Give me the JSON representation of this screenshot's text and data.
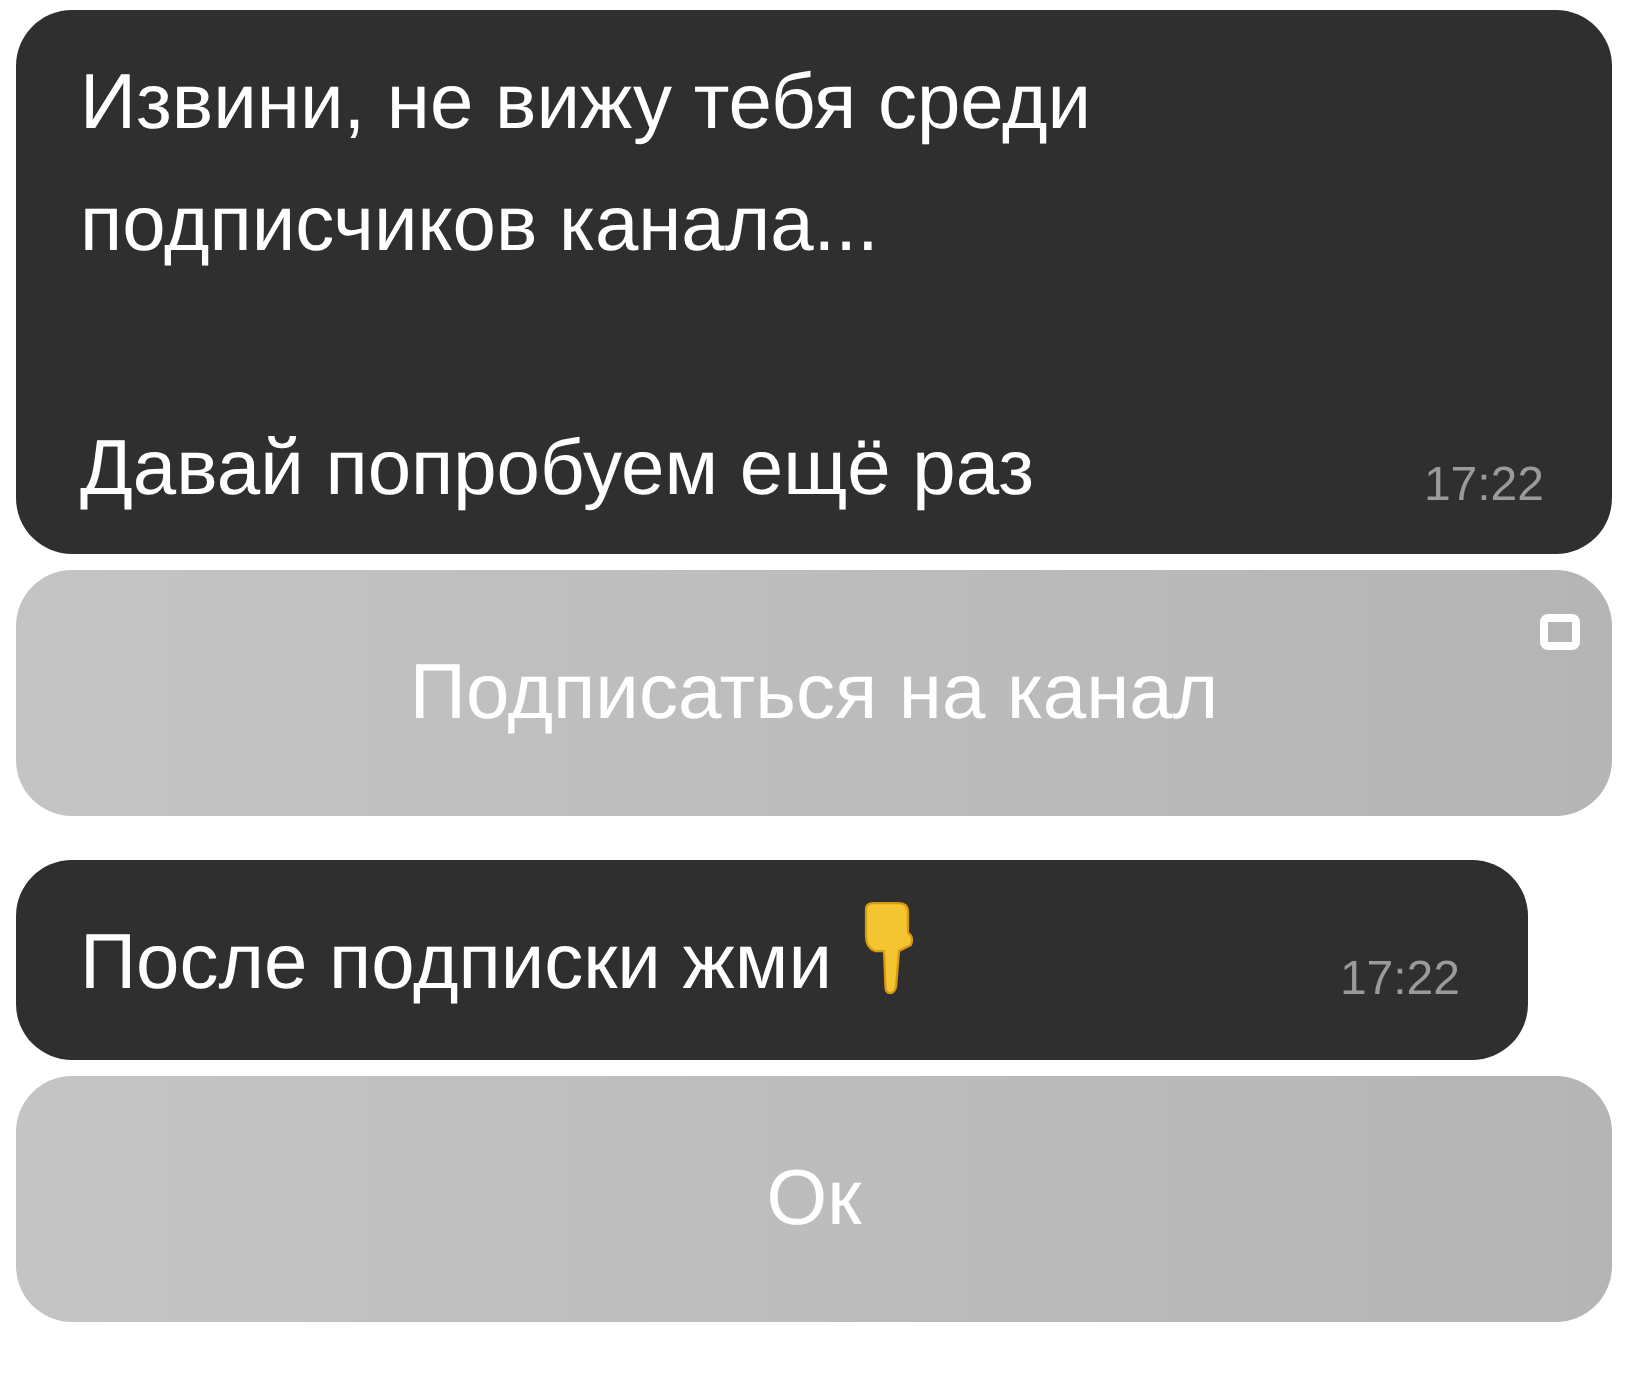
{
  "messages": [
    {
      "kind": "text",
      "text": "Извини, не вижу тебя среди подписчиков канала...\n\nДавай попробуем ещё раз",
      "time": "17:22",
      "pointer": false
    },
    {
      "kind": "button",
      "label": "Подписаться на канал",
      "corner_icon": true
    },
    {
      "kind": "text",
      "text": "После подписки жми",
      "time": "17:22",
      "pointer": true
    },
    {
      "kind": "button",
      "label": "Ок",
      "corner_icon": false
    }
  ]
}
